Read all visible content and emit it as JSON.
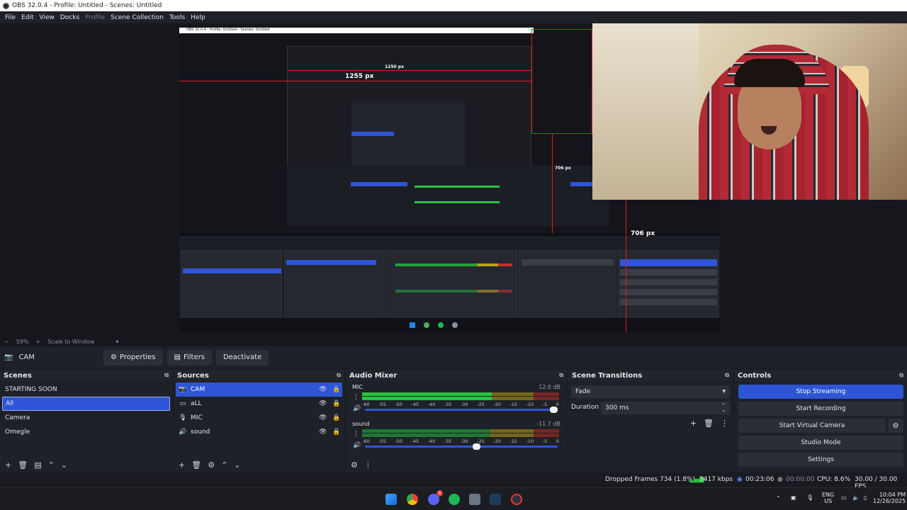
{
  "window": {
    "title": "OBS 32.0.4 - Profile: Untitled - Scenes: Untitled"
  },
  "menu": [
    "File",
    "Edit",
    "View",
    "Docks",
    "Profile",
    "Scene Collection",
    "Tools",
    "Help"
  ],
  "preview": {
    "measure_width": "1255 px",
    "measure_height_inner": "706 px",
    "measure_height": "706 px",
    "inner_title": "OBS 32.0.4 - Profile: Untitled - Scenes: Untitled",
    "inner_width": "1250 px"
  },
  "zoom": {
    "level": "59%",
    "mode": "Scale to Window"
  },
  "source_toolbar": {
    "source_name": "CAM",
    "properties": "Properties",
    "filters": "Filters",
    "deactivate": "Deactivate"
  },
  "scenes": {
    "title": "Scenes",
    "items": [
      "STARTING SOON",
      "All",
      "Camera",
      "Omegle"
    ],
    "selected": "All"
  },
  "sources": {
    "title": "Sources",
    "items": [
      {
        "name": "CAM",
        "icon": "camera-icon"
      },
      {
        "name": "aLL",
        "icon": "monitor-icon"
      },
      {
        "name": "MIC",
        "icon": "microphone-icon"
      },
      {
        "name": "sound",
        "icon": "speaker-icon"
      }
    ]
  },
  "mixer": {
    "title": "Audio Mixer",
    "tracks": [
      {
        "name": "MIC",
        "db": "12.0 dB",
        "level": 0.66,
        "volume": 1.0
      },
      {
        "name": "sound",
        "db": "-11.7 dB",
        "level": 0.0,
        "volume": 0.6
      }
    ],
    "ticks": [
      "-60",
      "-55",
      "-50",
      "-45",
      "-40",
      "-35",
      "-30",
      "-25",
      "-20",
      "-15",
      "-10",
      "-5",
      "0"
    ]
  },
  "transitions": {
    "title": "Scene Transitions",
    "selected": "Fade",
    "duration_label": "Duration",
    "duration_value": "300 ms"
  },
  "controls": {
    "title": "Controls",
    "stop_streaming": "Stop Streaming",
    "start_recording": "Start Recording",
    "start_virtual_camera": "Start Virtual Camera",
    "studio_mode": "Studio Mode",
    "settings": "Settings"
  },
  "status": {
    "dropped_frames": "Dropped Frames 734 (1.8%)",
    "bitrate": "3417 kbps",
    "stream_time": "00:23:06",
    "record_time": "00:00:00",
    "cpu": "CPU: 8.6%",
    "fps": "30.00 / 30.00 FPS"
  },
  "taskbar": {
    "lang": "ENG",
    "region": "US",
    "time": "10:04 PM",
    "date": "12/26/2025",
    "discord_badge": "8"
  },
  "colors": {
    "accent": "#2e55d6",
    "meter_green": "#29c23f",
    "meter_yellow": "#b8a21d",
    "meter_red": "#c63232",
    "measure_line": "#e21a1a"
  }
}
